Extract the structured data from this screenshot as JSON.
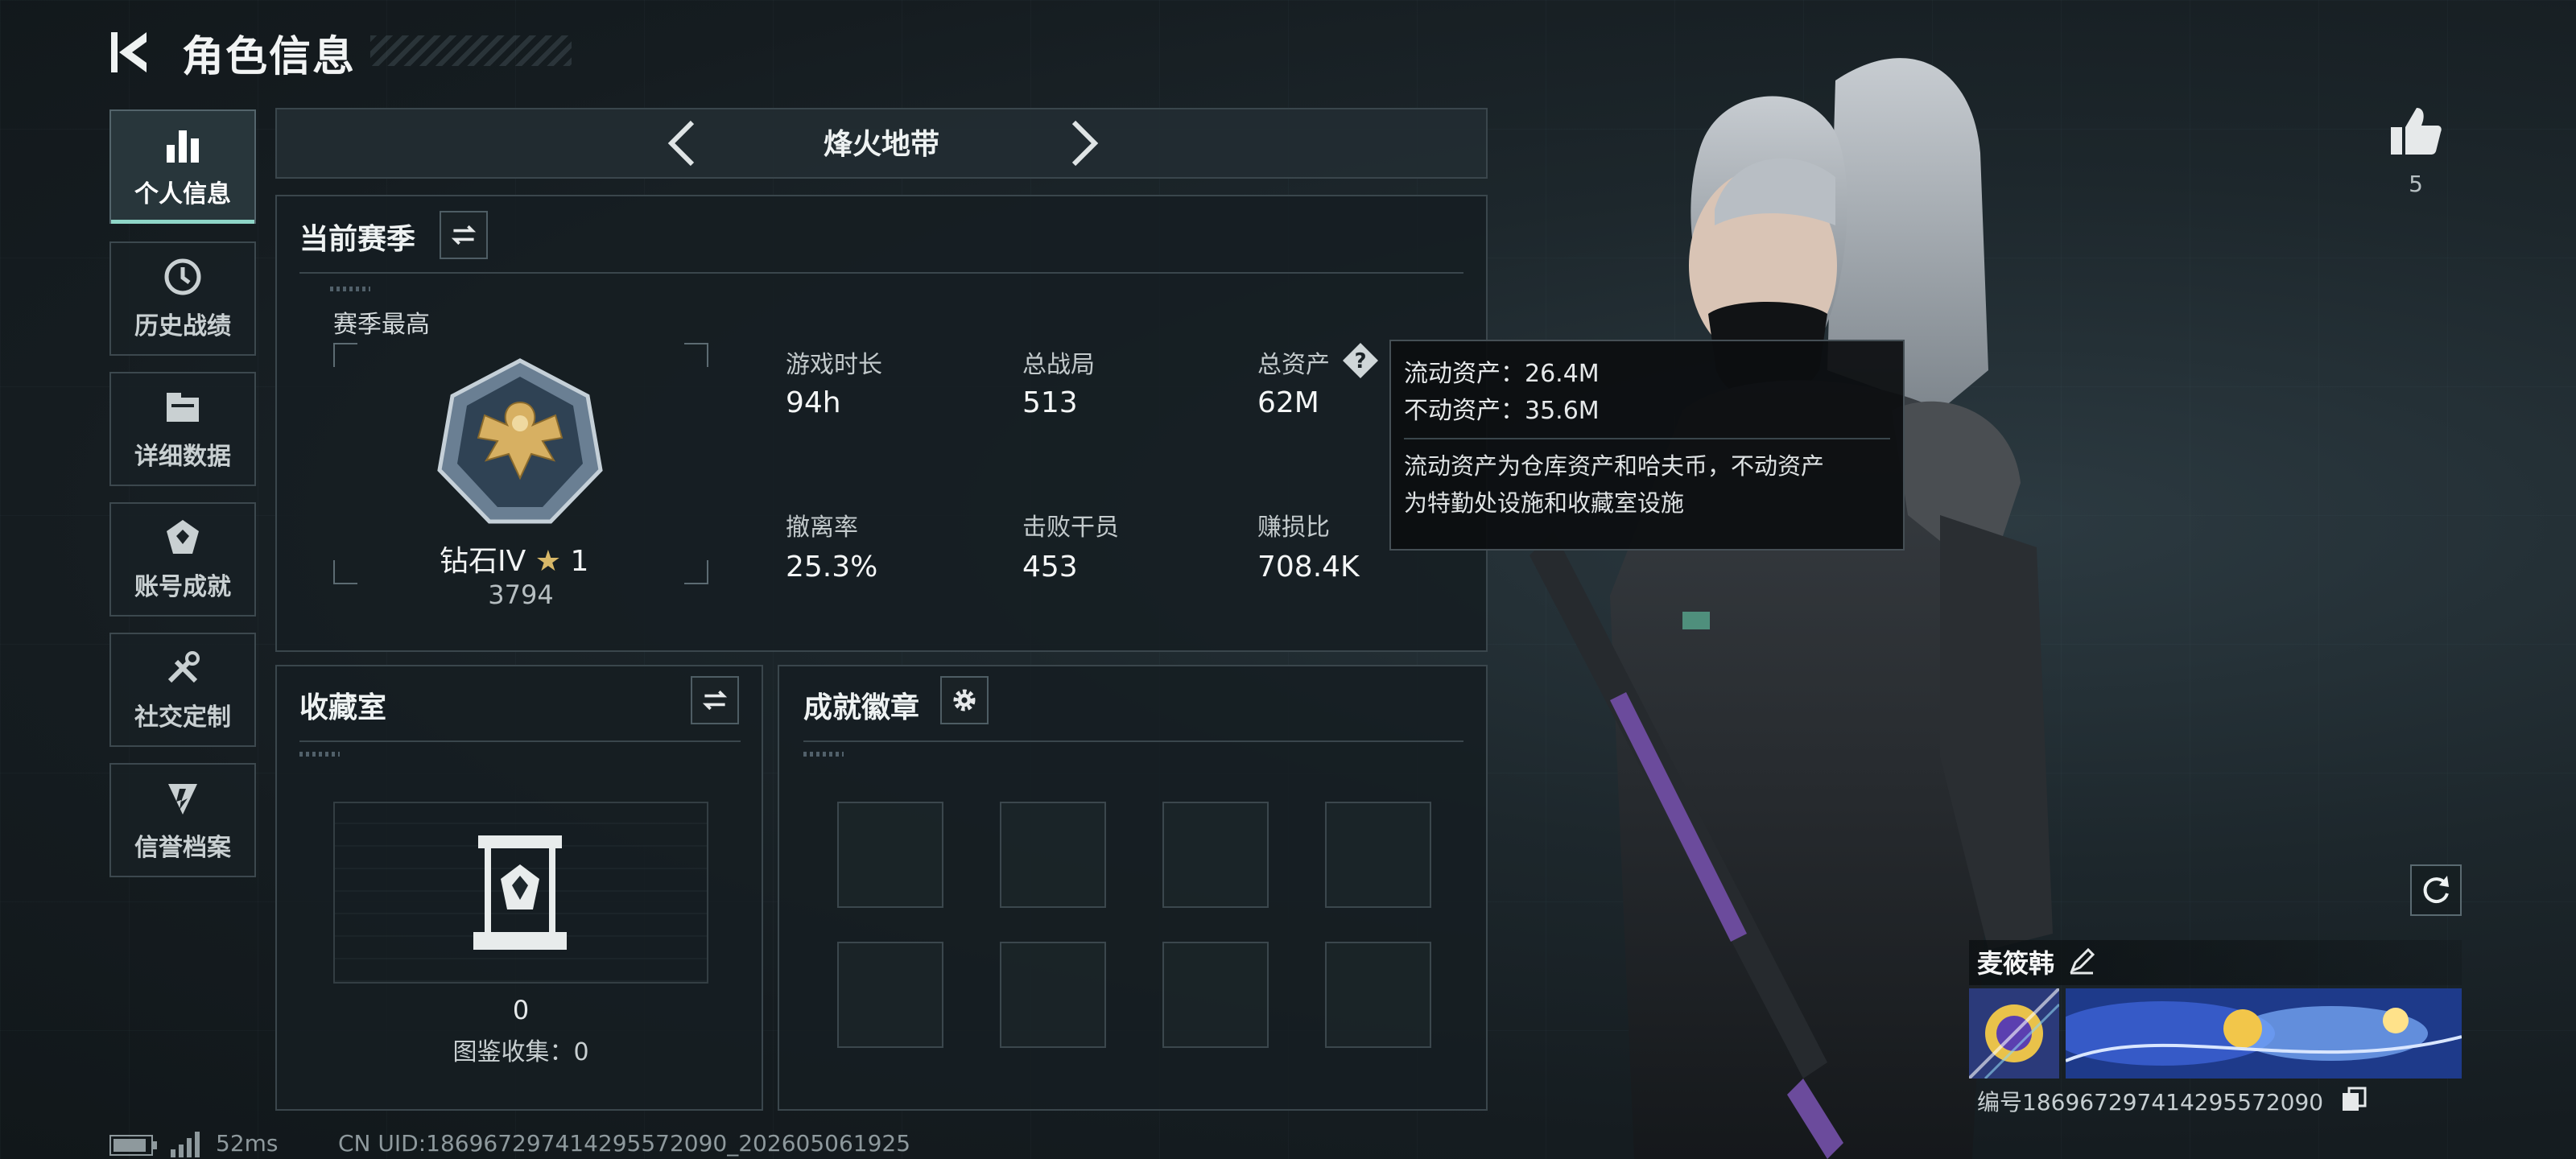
{
  "header": {
    "title": "角色信息"
  },
  "sidebar": {
    "items": [
      {
        "label": "个人信息",
        "icon": "bar-chart-icon",
        "active": true
      },
      {
        "label": "历史战绩",
        "icon": "history-icon"
      },
      {
        "label": "详细数据",
        "icon": "folder-icon"
      },
      {
        "label": "账号成就",
        "icon": "achievement-icon"
      },
      {
        "label": "社交定制",
        "icon": "tools-icon"
      },
      {
        "label": "信誉档案",
        "icon": "reputation-icon"
      }
    ]
  },
  "mode_selector": {
    "title": "烽火地带"
  },
  "season": {
    "title": "当前赛季",
    "best_label": "赛季最高",
    "rank_name": "钻石IV",
    "rank_stars": "1",
    "rank_score": "3794",
    "stats": [
      {
        "label": "游戏时长",
        "value": "94h"
      },
      {
        "label": "总战局",
        "value": "513"
      },
      {
        "label": "总资产",
        "value": "62M"
      },
      {
        "label": "撤离率",
        "value": "25.3%"
      },
      {
        "label": "击败干员",
        "value": "453"
      },
      {
        "label": "赚损比",
        "value": "708.4K"
      }
    ]
  },
  "tooltip": {
    "liquid": "流动资产：26.4M",
    "fixed": "不动资产：35.6M",
    "desc_line1": "流动资产为仓库资产和哈夫币，不动资产",
    "desc_line2": "为特勤处设施和收藏室设施"
  },
  "collection": {
    "title": "收藏室",
    "count": "0",
    "catalog": "图鉴收集：0"
  },
  "achievements": {
    "title": "成就徽章"
  },
  "likes": {
    "count": "5"
  },
  "player": {
    "name": "麦筱韩",
    "id_text": "编号1869672974142955720​90"
  },
  "footer": {
    "ping": "52ms",
    "uid": "CN UID:18696729741429557209​0_202605061925"
  },
  "colors": {
    "accent": "#8fd6c8",
    "panel_border": "#3a464c",
    "background": "#1d272c"
  }
}
